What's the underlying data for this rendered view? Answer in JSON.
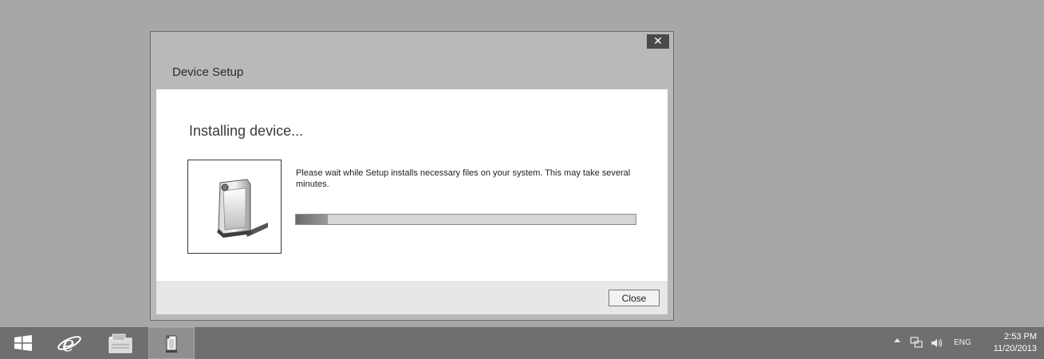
{
  "window": {
    "title": "Device Setup",
    "close_glyph": "✕",
    "heading": "Installing device...",
    "message": "Please wait while Setup installs necessary files on your system. This may take several minutes.",
    "progress_fraction": 0.095,
    "device_icon": "external-drive-icon",
    "close_button_label": "Close"
  },
  "taskbar": {
    "items": [
      {
        "icon": "windows-start-icon"
      },
      {
        "icon": "internet-explorer-icon"
      },
      {
        "icon": "file-explorer-icon"
      },
      {
        "icon": "device-setup-app-icon",
        "active": true
      }
    ],
    "tray": {
      "overflow_icon": "chevron-up-icon",
      "network_icon": "network-icon",
      "volume_icon": "volume-icon",
      "language": "ENG",
      "time": "2:53 PM",
      "date": "11/20/2013"
    }
  },
  "colors": {
    "desktop": "#a7a7a7",
    "taskbar": "#6f6f6f",
    "dialog_frame": "#b9b9b9",
    "progress_fill": "#7a7a7a"
  }
}
